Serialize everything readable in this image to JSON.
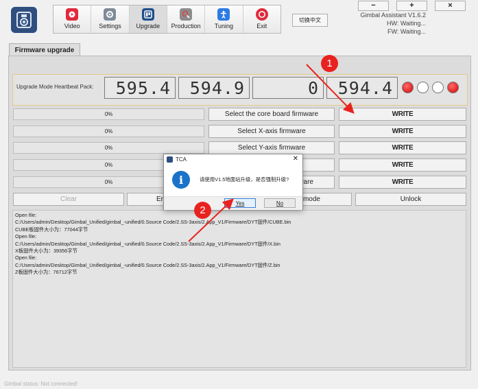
{
  "header": {
    "toolbar": [
      {
        "label": "Video",
        "icon": "video-icon",
        "color": "#e02b3c"
      },
      {
        "label": "Settings",
        "icon": "settings-icon",
        "color": "#7e8b99"
      },
      {
        "label": "Upgrade",
        "icon": "upgrade-icon",
        "color": "#1f4e8c"
      },
      {
        "label": "Production",
        "icon": "production-icon",
        "color": "#8c8c8c"
      },
      {
        "label": "Tuning",
        "icon": "tuning-icon",
        "color": "#2c7be5"
      },
      {
        "label": "Exit",
        "icon": "exit-icon",
        "color": "#e02b3c"
      }
    ],
    "active_tab": "Upgrade",
    "language_button": "切换中文",
    "window_controls": [
      "−",
      "+",
      "×"
    ],
    "app_name": "Gimbal Assistant V1.6.2",
    "hw": "HW: Waiting...",
    "fw": "FW: Waiting..."
  },
  "tab_title": "Firmware upgrade",
  "heartbeat": {
    "label": "Upgrade Mode Heartbeat Pack:",
    "values": [
      "595.4",
      "594.9",
      "0",
      "594.4"
    ],
    "leds": [
      true,
      false,
      false,
      true
    ]
  },
  "rows": [
    {
      "progress": "0%",
      "progress_value": 0,
      "select": "Select the core board firmware",
      "write": "WRITE"
    },
    {
      "progress": "0%",
      "progress_value": 0,
      "select": "Select X-axis firmware",
      "write": "WRITE"
    },
    {
      "progress": "0%",
      "progress_value": 0,
      "select": "Select Y-axis firmware",
      "write": "WRITE"
    },
    {
      "progress": "0%",
      "progress_value": 0,
      "select": "",
      "write": "WRITE"
    },
    {
      "progress": "0%",
      "progress_value": 0,
      "select": "ware",
      "write": "WRITE"
    }
  ],
  "bottom_buttons": {
    "clear": "Clear",
    "enter": "Ent",
    "mode": "e mode",
    "unlock": "Unlock"
  },
  "log": [
    "Open file:",
    "C:/Users/admin/Desktop/Gimbal_Unified/gimbal_-unified/0.Source Code/2.SS-3axis/2.App_V1/Firmware/DYT固件/CUBE.bin",
    "CUBE板固件大小为：77044字节",
    "Open file:",
    "C:/Users/admin/Desktop/Gimbal_Unified/gimbal_-unified/0.Source Code/2.SS-3axis/2.App_V1/Firmware/DYT固件/X.bin",
    "X板固件大小为：39356字节",
    "Open file:",
    "C:/Users/admin/Desktop/Gimbal_Unified/gimbal_-unified/0.Source Code/2.SS-3axis/2.App_V1/Firmware/DYT固件/Z.bin",
    "Z板固件大小为：76712字节"
  ],
  "status_bar": "Gimbal status: Not connected!",
  "dialog": {
    "title": "TCA",
    "message": "请使用V1.5地面站升级，是否强制升级?",
    "yes": "Yes",
    "no": "No",
    "icon": "info-icon",
    "accent": "#1a73c8"
  },
  "annotations": [
    "1",
    "2"
  ],
  "colors": {
    "annotation": "#e8231f",
    "led_on": "#d40000"
  }
}
